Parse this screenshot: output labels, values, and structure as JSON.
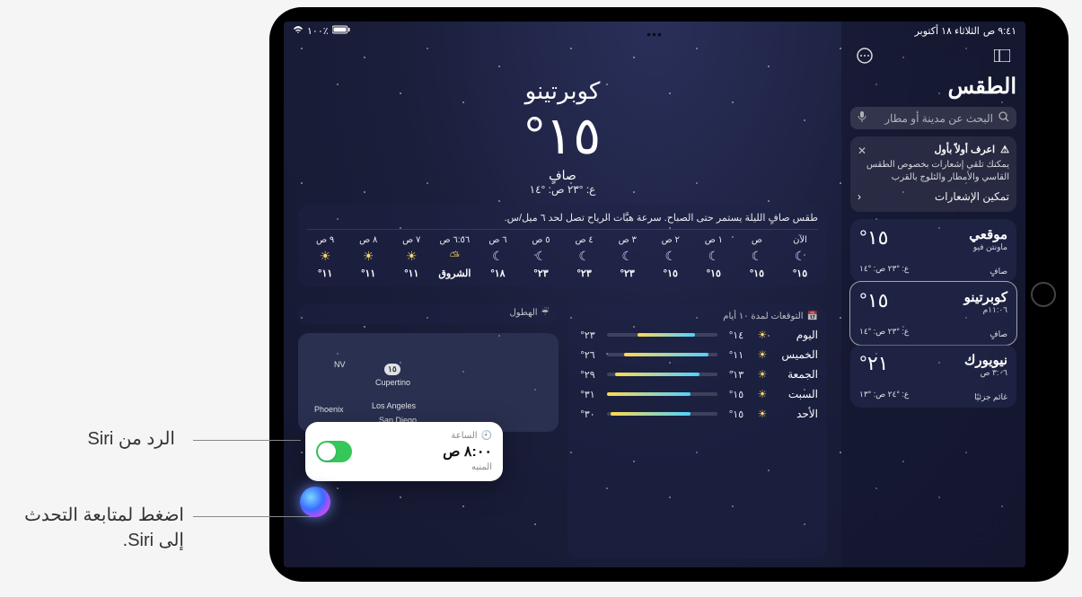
{
  "status": {
    "time": "٩:٤١ ص",
    "date": "الثلاثاء ١٨ أكتوبر",
    "battery": "١٠٠٪"
  },
  "sidebar": {
    "title": "الطقس",
    "search_placeholder": "البحث عن مدينة أو مطار",
    "notif": {
      "title": "اعرف أولاً بأول",
      "body": "يمكنك تلقي إشعارات بخصوص الطقس القاسي والأمطار والثلوج بالقرب",
      "enable": "تمكين الإشعارات"
    },
    "cities": [
      {
        "name": "موقعي",
        "sub": "ماونتن فيو",
        "temp": "°١٥",
        "cond": "صافٍ",
        "range": "ع: °٢٣ ص: °١٤"
      },
      {
        "name": "كوبرتينو",
        "sub": "١١:٠٦م",
        "temp": "°١٥",
        "cond": "صافٍ",
        "range": "ع: °٢٣ ص: °١٤"
      },
      {
        "name": "نيويورك",
        "sub": "٣:٠٦ ص",
        "temp": "°٢١",
        "cond": "غائم جزئيًا",
        "range": "ع: °٢٤ ص: °١٣"
      }
    ]
  },
  "hero": {
    "city": "كوبرتينو",
    "temp": "°١٥",
    "cond": "صافٍ",
    "range": "ع: °٢٣ ص: °١٤"
  },
  "hourly": {
    "desc": "طقس صافٍ الليلة يستمر حتى الصباح. سرعة هبَّات الرياح تصل لحد ٦ ميل/س.",
    "items": [
      {
        "t": "الآن",
        "icon": "moon",
        "temp": "°١٥"
      },
      {
        "t": "ص",
        "icon": "moon",
        "temp": "°١٥"
      },
      {
        "t": "١ ص",
        "icon": "moon",
        "temp": "°١٥"
      },
      {
        "t": "٢ ص",
        "icon": "moon",
        "temp": "°١٥"
      },
      {
        "t": "٣ ص",
        "icon": "moon",
        "temp": "°٢٣"
      },
      {
        "t": "٤ ص",
        "icon": "moon",
        "temp": "°٢٣"
      },
      {
        "t": "٥ ص",
        "icon": "moon",
        "temp": "°٢٣"
      },
      {
        "t": "٦ ص",
        "icon": "moon",
        "temp": "°١٨"
      },
      {
        "t": "٦:٥٦ ص",
        "icon": "sunrise",
        "temp": "الشروق"
      },
      {
        "t": "٧ ص",
        "icon": "sun",
        "temp": "°١١"
      },
      {
        "t": "٨ ص",
        "icon": "sun",
        "temp": "°١١"
      },
      {
        "t": "٩ ص",
        "icon": "sun",
        "temp": "°١١"
      }
    ]
  },
  "daily": {
    "title": "التوقعات لمدة ١٠ أيام",
    "items": [
      {
        "day": "اليوم",
        "lo": "°١٤",
        "hi": "°٢٣",
        "from": 20,
        "to": 72
      },
      {
        "day": "الخميس",
        "lo": "°١١",
        "hi": "°٢٦",
        "from": 8,
        "to": 84
      },
      {
        "day": "الجمعة",
        "lo": "°١٣",
        "hi": "°٢٩",
        "from": 16,
        "to": 92
      },
      {
        "day": "السبت",
        "lo": "°١٥",
        "hi": "°٣١",
        "from": 24,
        "to": 100
      },
      {
        "day": "الأحد",
        "lo": "°١٥",
        "hi": "°٣٠",
        "from": 24,
        "to": 96
      }
    ]
  },
  "precip": {
    "title": "الهطول"
  },
  "map": {
    "pins": [
      "Cupertino",
      "Los Angeles",
      "San Diego",
      "Phoenix",
      "NV"
    ],
    "badge": "١٥"
  },
  "siri": {
    "app": "الساعة",
    "time": "٨:٠٠ ص",
    "sub": "المنبه"
  },
  "callouts": {
    "response": "الرد من Siri",
    "tap": "اضغط لمتابعة التحدث إلى Siri."
  }
}
